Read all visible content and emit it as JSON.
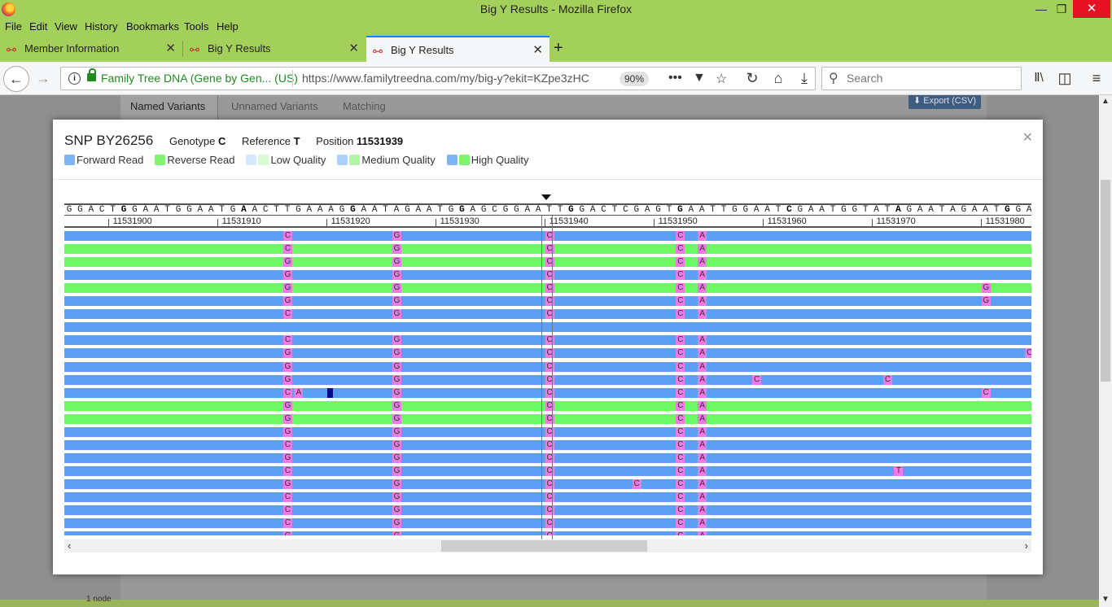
{
  "window": {
    "title": "Big Y Results - Mozilla Firefox",
    "minimize": "—",
    "maximize": "❐",
    "close": "✕"
  },
  "menu": [
    "File",
    "Edit",
    "View",
    "History",
    "Bookmarks",
    "Tools",
    "Help"
  ],
  "tabs": [
    {
      "label": "Member Information",
      "active": false
    },
    {
      "label": "Big Y Results",
      "active": false
    },
    {
      "label": "Big Y Results",
      "active": true
    }
  ],
  "tab_icon": "dna-icon",
  "nav": {
    "identity": "Family Tree DNA (Gene by Gen... (US)",
    "url": "https://www.familytreedna.com/my/big-y?ekit=KZpe3zHC",
    "zoom": "90%",
    "search_placeholder": "Search",
    "more": "•••"
  },
  "page": {
    "tabs": [
      "Named Variants",
      "Unnamed Variants",
      "Matching"
    ],
    "export_label": "⬇ Export (CSV)",
    "footer_text": "1 node"
  },
  "snp": {
    "name": "SNP BY26256",
    "genotype_label": "Genotype",
    "genotype": "C",
    "reference_label": "Reference",
    "reference": "T",
    "position_label": "Position",
    "position": "11531939"
  },
  "legend": [
    {
      "label": "Forward Read",
      "colors": [
        "#7cb4f7"
      ]
    },
    {
      "label": "Reverse Read",
      "colors": [
        "#7ff472"
      ]
    },
    {
      "label": "Low Quality",
      "colors": [
        "#d6e8fc",
        "#d9f9d2"
      ]
    },
    {
      "label": "Medium Quality",
      "colors": [
        "#aed0fa",
        "#b3f6aa"
      ]
    },
    {
      "label": "High Quality",
      "colors": [
        "#7cb4f7",
        "#7ff472"
      ]
    }
  ],
  "colors": {
    "forward": "#5d9ef3",
    "reverse": "#6df766",
    "variant": "#ee7ae6",
    "lowqual": "#0b0b88"
  },
  "reference_sequence": "GGACTGGAATGGAATGAACTTGAAAGGAATAGAATGGAGCGGAATTGGACTCGAGTGAATTGGAATCGAATGGTATAGAATAGAATGGAA",
  "bold_bases": [
    5,
    16,
    26,
    36,
    46,
    56,
    66,
    76,
    86
  ],
  "position_labels": [
    "11531900",
    "11531910",
    "11531920",
    "11531930",
    "11531940",
    "11531950",
    "11531960",
    "11531970",
    "11531980"
  ],
  "reads": [
    {
      "dir": "F",
      "vars": [
        [
          "C",
          20
        ],
        [
          "G",
          30
        ],
        [
          "C",
          44
        ],
        [
          "C",
          56
        ],
        [
          "A",
          58
        ]
      ]
    },
    {
      "dir": "R",
      "vars": [
        [
          "C",
          20
        ],
        [
          "G",
          30
        ],
        [
          "C",
          44
        ],
        [
          "C",
          56
        ],
        [
          "A",
          58
        ]
      ]
    },
    {
      "dir": "R",
      "vars": [
        [
          "G",
          20
        ],
        [
          "G",
          30
        ],
        [
          "C",
          44
        ],
        [
          "C",
          56
        ],
        [
          "A",
          58
        ]
      ]
    },
    {
      "dir": "F",
      "vars": [
        [
          "G",
          20
        ],
        [
          "G",
          30
        ],
        [
          "C",
          44
        ],
        [
          "C",
          56
        ],
        [
          "A",
          58
        ]
      ]
    },
    {
      "dir": "R",
      "vars": [
        [
          "G",
          20
        ],
        [
          "G",
          30
        ],
        [
          "C",
          44
        ],
        [
          "C",
          56
        ],
        [
          "A",
          58
        ],
        [
          "G",
          84
        ]
      ]
    },
    {
      "dir": "F",
      "vars": [
        [
          "G",
          20
        ],
        [
          "G",
          30
        ],
        [
          "C",
          44
        ],
        [
          "C",
          56
        ],
        [
          "A",
          58
        ],
        [
          "G",
          84
        ]
      ]
    },
    {
      "dir": "F",
      "vars": [
        [
          "C",
          20
        ],
        [
          "G",
          30
        ],
        [
          "C",
          44
        ],
        [
          "C",
          56
        ],
        [
          "A",
          58
        ]
      ]
    },
    {
      "dir": "F",
      "vars": []
    },
    {
      "dir": "F",
      "vars": [
        [
          "C",
          20
        ],
        [
          "G",
          30
        ],
        [
          "C",
          44
        ],
        [
          "C",
          56
        ],
        [
          "A",
          58
        ]
      ]
    },
    {
      "dir": "F",
      "vars": [
        [
          "G",
          20
        ],
        [
          "G",
          30
        ],
        [
          "C",
          44
        ],
        [
          "C",
          56
        ],
        [
          "A",
          58
        ],
        [
          "C",
          88
        ]
      ]
    },
    {
      "dir": "F",
      "vars": [
        [
          "G",
          20
        ],
        [
          "G",
          30
        ],
        [
          "C",
          44
        ],
        [
          "C",
          56
        ],
        [
          "A",
          58
        ]
      ]
    },
    {
      "dir": "F",
      "vars": [
        [
          "G",
          20
        ],
        [
          "G",
          30
        ],
        [
          "C",
          44
        ],
        [
          "C",
          56
        ],
        [
          "A",
          58
        ],
        [
          "C",
          63
        ],
        [
          "C",
          75
        ]
      ]
    },
    {
      "dir": "F",
      "vars": [
        [
          "C",
          20
        ],
        [
          "A",
          21
        ],
        [
          "",
          24
        ],
        [
          "G",
          30
        ],
        [
          "C",
          44
        ],
        [
          "C",
          56
        ],
        [
          "A",
          58
        ],
        [
          "C",
          84
        ]
      ]
    },
    {
      "dir": "R",
      "vars": [
        [
          "G",
          20
        ],
        [
          "G",
          30
        ],
        [
          "C",
          44
        ],
        [
          "C",
          56
        ],
        [
          "A",
          58
        ]
      ]
    },
    {
      "dir": "R",
      "vars": [
        [
          "G",
          20
        ],
        [
          "G",
          30
        ],
        [
          "C",
          44
        ],
        [
          "C",
          56
        ],
        [
          "A",
          58
        ]
      ]
    },
    {
      "dir": "F",
      "vars": [
        [
          "G",
          20
        ],
        [
          "G",
          30
        ],
        [
          "C",
          44
        ],
        [
          "C",
          56
        ],
        [
          "A",
          58
        ]
      ]
    },
    {
      "dir": "F",
      "vars": [
        [
          "C",
          20
        ],
        [
          "G",
          30
        ],
        [
          "C",
          44
        ],
        [
          "C",
          56
        ],
        [
          "A",
          58
        ]
      ]
    },
    {
      "dir": "F",
      "vars": [
        [
          "G",
          20
        ],
        [
          "G",
          30
        ],
        [
          "C",
          44
        ],
        [
          "C",
          56
        ],
        [
          "A",
          58
        ]
      ]
    },
    {
      "dir": "F",
      "vars": [
        [
          "C",
          20
        ],
        [
          "G",
          30
        ],
        [
          "C",
          44
        ],
        [
          "C",
          56
        ],
        [
          "A",
          58
        ],
        [
          "T",
          76
        ]
      ]
    },
    {
      "dir": "F",
      "vars": [
        [
          "G",
          20
        ],
        [
          "G",
          30
        ],
        [
          "C",
          44
        ],
        [
          "C",
          52
        ],
        [
          "C",
          56
        ],
        [
          "A",
          58
        ]
      ]
    },
    {
      "dir": "F",
      "vars": [
        [
          "C",
          20
        ],
        [
          "G",
          30
        ],
        [
          "C",
          44
        ],
        [
          "C",
          56
        ],
        [
          "A",
          58
        ]
      ]
    },
    {
      "dir": "F",
      "vars": [
        [
          "C",
          20
        ],
        [
          "G",
          30
        ],
        [
          "C",
          44
        ],
        [
          "C",
          56
        ],
        [
          "A",
          58
        ]
      ]
    },
    {
      "dir": "F",
      "vars": [
        [
          "C",
          20
        ],
        [
          "G",
          30
        ],
        [
          "C",
          44
        ],
        [
          "C",
          56
        ],
        [
          "A",
          58
        ]
      ]
    },
    {
      "dir": "F",
      "vars": [
        [
          "G",
          20
        ],
        [
          "G",
          30
        ],
        [
          "C",
          44
        ],
        [
          "C",
          56
        ],
        [
          "A",
          58
        ]
      ]
    }
  ]
}
